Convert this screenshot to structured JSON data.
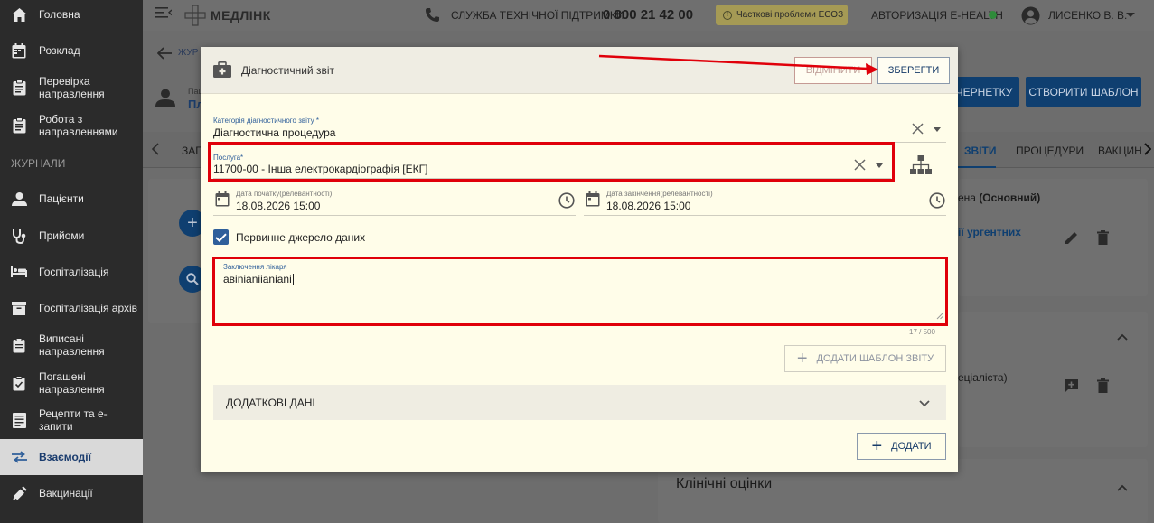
{
  "sidebar": {
    "items": [
      {
        "label": "Головна",
        "icon": "home-icon"
      },
      {
        "label": "Розклад",
        "icon": "calendar-icon"
      },
      {
        "label": "Перевірка направлення",
        "icon": "clipboard-icon"
      },
      {
        "label": "Робота з направленнями",
        "icon": "clipboard-icon"
      },
      {
        "label": "Пацієнти",
        "icon": "person-icon"
      },
      {
        "label": "Прийоми",
        "icon": "stethoscope-icon"
      },
      {
        "label": "Госпіталізація",
        "icon": "bed-icon"
      },
      {
        "label": "Госпіталізація архів",
        "icon": "archive-icon"
      },
      {
        "label": "Виписані направлення",
        "icon": "document-icon"
      },
      {
        "label": "Погашені направлення",
        "icon": "clipboard-check-icon"
      },
      {
        "label": "Рецепти та е-запити",
        "icon": "list-icon"
      },
      {
        "label": "Взаємодії",
        "icon": "swap-icon"
      },
      {
        "label": "Вакцинації",
        "icon": "syringe-icon"
      }
    ],
    "section_label": "ЖУРНАЛИ",
    "active_index": 11
  },
  "topbar": {
    "logo": "МЕДЛІНК",
    "support_label": "СЛУЖБА ТЕХНІЧНОЇ ПІДТРИМКИ",
    "support_phone": "0 800 21 42 00",
    "warning": "Часткові проблеми ЕСОЗ",
    "ehealth": "АВТОРИЗАЦІЯ E-HEALTH",
    "ehealth_status_color": "#2e8b3a",
    "user": "ЛИСЕНКО В. В."
  },
  "background": {
    "journal": "ЖУР",
    "pac": "Паці",
    "pl": "Пл",
    "btn_draft": "ЧЕРНЕТКУ",
    "btn_template": "СТВОРИТИ ШАБЛОН",
    "tab_first": "ЗАГ",
    "tab_active": "ЗВІТИ",
    "tab_procedures": "ПРОЦЕДУРИ",
    "tab_vaccin": "ВАКЦИН",
    "main_text_prefix": "ена ",
    "main_text_bold": "(Основний)",
    "link_text": "ії ургентних",
    "spec_text": "еціаліста)",
    "clinical": "Клінічні оцінки"
  },
  "modal": {
    "title": "Діагностичний звіт",
    "cancel": "ВІДМІНИТИ",
    "save": "ЗБЕРЕГТИ",
    "category_label": "Категорія діагностичного звіту *",
    "category_value": "Діагностична процедура",
    "service_label": "Послуга*",
    "service_value": "11700-00 - Інша електрокардіографія [ЕКГ]",
    "start_label": "Дата початку(релевантності)",
    "start_value": "18.08.2026 15:00",
    "end_label": "Дата закінчення(релевантності)",
    "end_value": "18.08.2026 15:00",
    "checkbox_label": "Первинне джерело даних",
    "checkbox_checked": true,
    "conclusion_label": "Заключення лікаря",
    "conclusion_value": "aвinianiianiani",
    "counter": "17 / 500",
    "add_template": "ДОДАТИ ШАБЛОН ЗВІТУ",
    "additional": "ДОДАТКОВІ ДАНІ",
    "add": "ДОДАТИ"
  },
  "annotation_color": "#e0000a"
}
